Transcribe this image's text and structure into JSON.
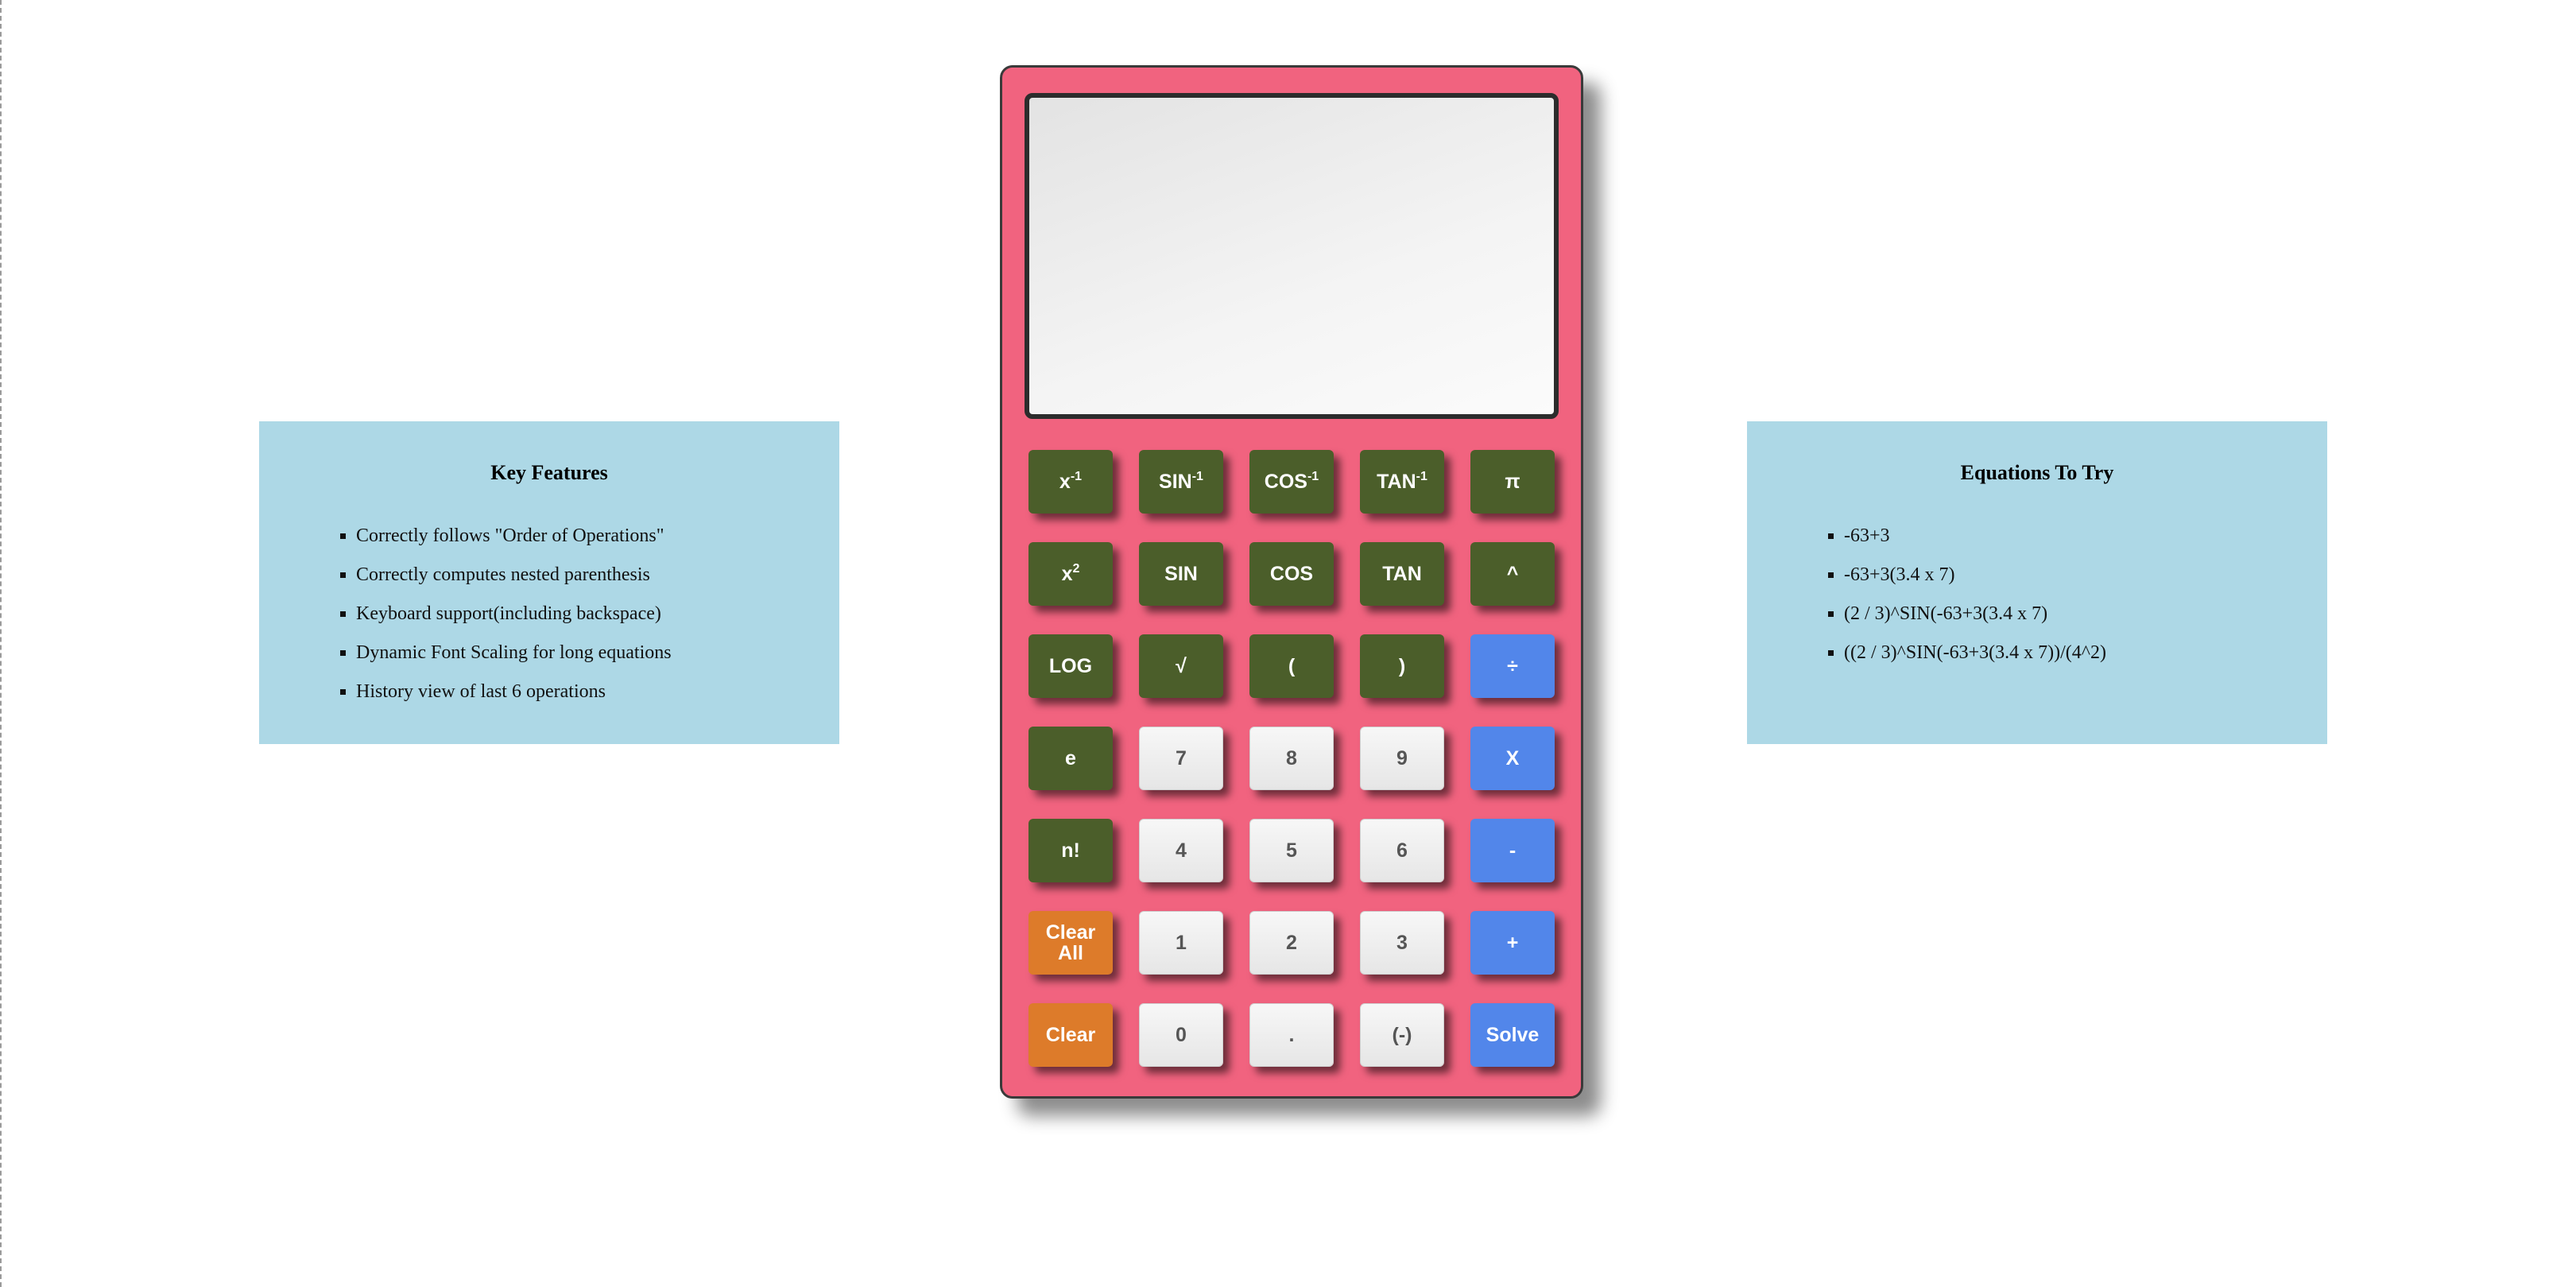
{
  "features_panel": {
    "title": "Key Features",
    "items": [
      "Correctly follows \"Order of Operations\"",
      "Correctly computes nested parenthesis",
      "Keyboard support(including backspace)",
      "Dynamic Font Scaling for long equations",
      "History view of last 6 operations"
    ]
  },
  "equations_panel": {
    "title": "Equations To Try",
    "items": [
      "-63+3",
      "-63+3(3.4 x 7)",
      "(2 / 3)^SIN(-63+3(3.4 x 7)",
      "((2 / 3)^SIN(-63+3(3.4 x 7))/(4^2)"
    ]
  },
  "calculator": {
    "display_value": "",
    "keys": {
      "inverse": {
        "base": "x",
        "sup": "-1"
      },
      "asin": {
        "base": "SIN",
        "sup": "-1"
      },
      "acos": {
        "base": "COS",
        "sup": "-1"
      },
      "atan": {
        "base": "TAN",
        "sup": "-1"
      },
      "pi": "π",
      "square": {
        "base": "x",
        "sup": "2"
      },
      "sin": "SIN",
      "cos": "COS",
      "tan": "TAN",
      "power": "^",
      "log": "LOG",
      "sqrt": "√",
      "open_paren": "(",
      "close_paren": ")",
      "divide": "÷",
      "e": "e",
      "seven": "7",
      "eight": "8",
      "nine": "9",
      "multiply": "X",
      "factorial": "n!",
      "four": "4",
      "five": "5",
      "six": "6",
      "minus": "-",
      "clear_all": "Clear All",
      "one": "1",
      "two": "2",
      "three": "3",
      "plus": "+",
      "clear": "Clear",
      "zero": "0",
      "decimal": ".",
      "negate": "(-)",
      "solve": "Solve"
    }
  },
  "colors": {
    "calculator_body": "#f1637f",
    "function_key": "#4b5e2a",
    "number_key": "#efefef",
    "operator_key": "#5286ea",
    "clear_key": "#dd7b2a",
    "panel_background": "#add8e6"
  }
}
